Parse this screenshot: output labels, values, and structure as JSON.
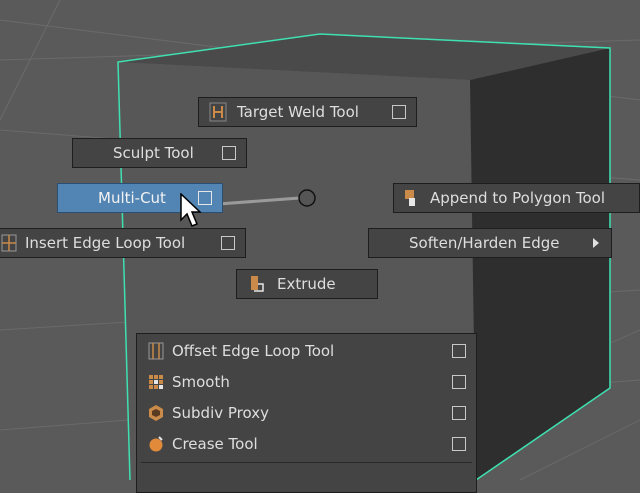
{
  "marking_menu": {
    "target_weld_tool": {
      "label": "Target Weld Tool",
      "icon": "target-weld-icon"
    },
    "sculpt_tool": {
      "label": "Sculpt Tool"
    },
    "multi_cut": {
      "label": "Multi-Cut"
    },
    "insert_edge_loop_tool": {
      "label": "Insert Edge Loop Tool",
      "icon": "insert-edge-loop-icon"
    },
    "append_to_polygon_tool": {
      "label": "Append to Polygon Tool",
      "icon": "append-polygon-icon"
    },
    "soften_harden_edge": {
      "label": "Soften/Harden Edge"
    },
    "extrude": {
      "label": "Extrude",
      "icon": "extrude-icon"
    }
  },
  "submenu": {
    "items": [
      {
        "label": "Offset Edge Loop Tool",
        "icon": "offset-edge-loop-icon"
      },
      {
        "label": "Smooth",
        "icon": "smooth-icon"
      },
      {
        "label": "Subdiv Proxy",
        "icon": "subdiv-proxy-icon"
      },
      {
        "label": "Crease Tool",
        "icon": "crease-tool-icon"
      }
    ]
  },
  "colors": {
    "viewport_bg": "#5a5a5a",
    "cube_dark": "#2e2e2e",
    "cube_outline": "#3fe0b0",
    "menu_bg": "#444444",
    "highlight": "#5285b3"
  }
}
